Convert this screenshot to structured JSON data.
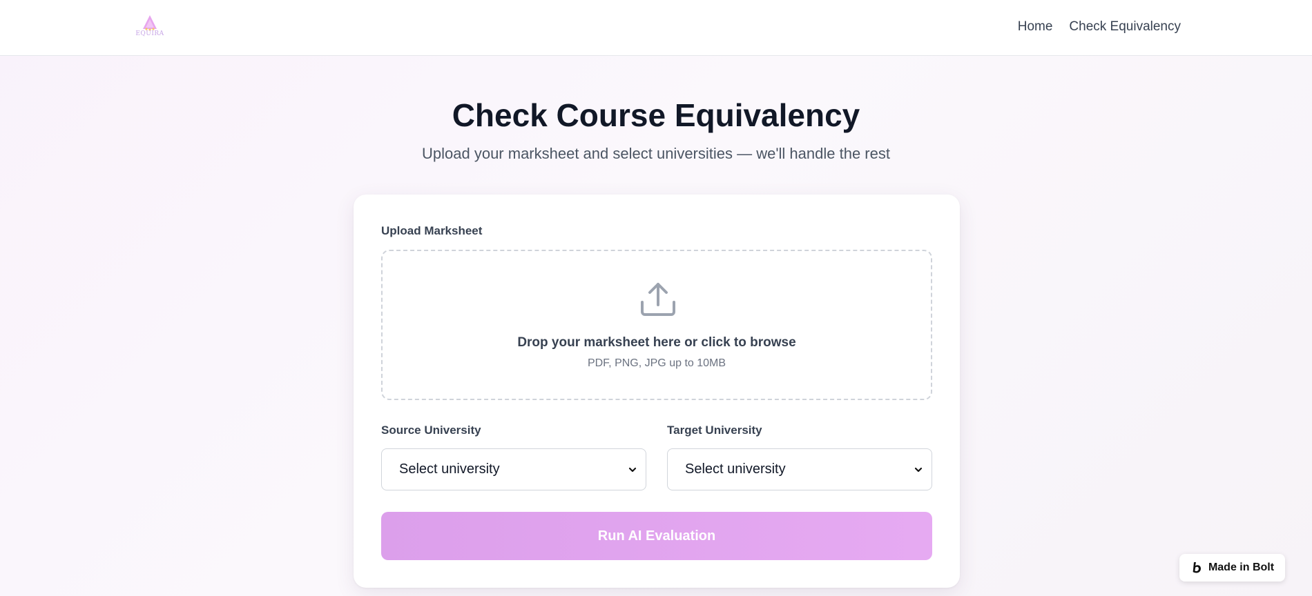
{
  "brand": {
    "logo_text": "EQUIRA"
  },
  "nav": {
    "home": "Home",
    "check_equivalency": "Check Equivalency"
  },
  "hero": {
    "title": "Check Course Equivalency",
    "subtitle": "Upload your marksheet and select universities — we'll handle the rest"
  },
  "form": {
    "upload_label": "Upload Marksheet",
    "drop_text": "Drop your marksheet here or click to browse",
    "drop_hint": "PDF, PNG, JPG up to 10MB",
    "source_label": "Source University",
    "source_value": "Select university",
    "target_label": "Target University",
    "target_value": "Select university",
    "run_label": "Run AI Evaluation"
  },
  "badge": {
    "label": "Made in Bolt"
  },
  "colors": {
    "accent": "#dc9feb",
    "accent_end": "#e6aaf2",
    "logo": "#c7a5e6"
  },
  "icons": {
    "upload": "upload-icon",
    "chevron": "chevron-down-icon",
    "bolt": "bolt-logo-icon"
  }
}
